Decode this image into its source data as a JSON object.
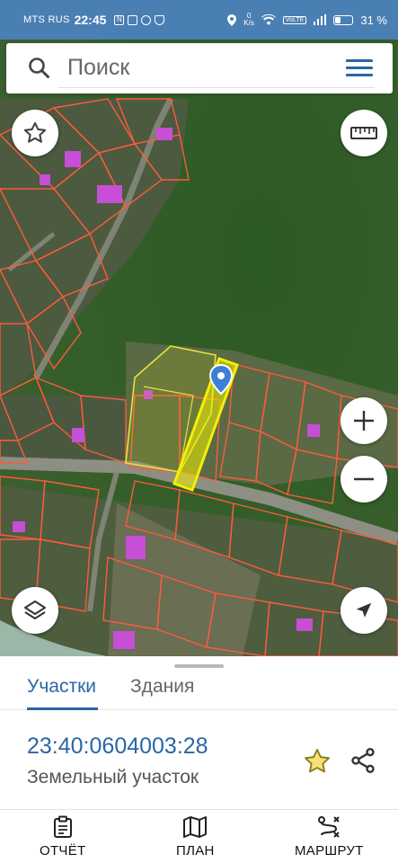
{
  "status_bar": {
    "carrier": "MTS RUS",
    "time": "22:45",
    "speed_value": "0",
    "speed_unit": "K/s",
    "network": "VoLTE",
    "battery_percent": "31 %",
    "battery_level": 0.31
  },
  "search": {
    "placeholder": "Поиск"
  },
  "bottom_sheet": {
    "tabs": [
      {
        "label": "Участки",
        "active": true
      },
      {
        "label": "Здания",
        "active": false
      }
    ],
    "parcel": {
      "number": "23:40:0604003:28",
      "type": "Земельный участок"
    }
  },
  "bottom_nav": {
    "items": [
      {
        "label": "ОТЧЁТ",
        "icon": "report-icon"
      },
      {
        "label": "ПЛАН",
        "icon": "map-plan-icon"
      },
      {
        "label": "МАРШРУТ",
        "icon": "route-icon"
      }
    ]
  },
  "map_controls": {
    "favorite": "star-icon",
    "ruler": "ruler-icon",
    "zoom_in": "plus-icon",
    "zoom_out": "minus-icon",
    "layers": "layers-icon",
    "locate": "navigation-arrow-icon"
  },
  "colors": {
    "accent": "#2b66a6",
    "status_bar": "#4a7fb3",
    "parcel_outline": "#ff5a3c",
    "selected_parcel": "#f4f000",
    "building_fill": "#c64fd6",
    "marker": "#3d7fd6"
  }
}
